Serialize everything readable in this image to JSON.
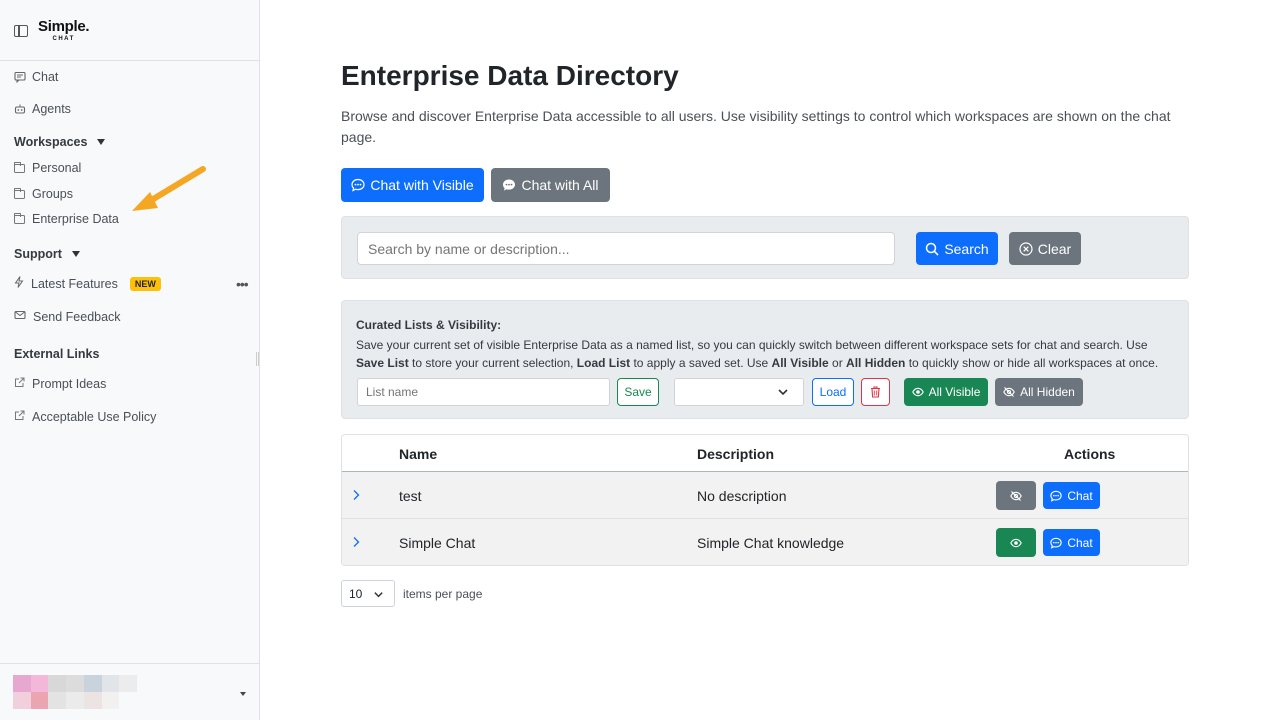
{
  "brand": {
    "line1": "Simple.",
    "line2": "CHAT"
  },
  "sidebar": {
    "chat": "Chat",
    "agents": "Agents",
    "workspaces": {
      "title": "Workspaces",
      "items": [
        "Personal",
        "Groups",
        "Enterprise Data"
      ]
    },
    "support": {
      "title": "Support",
      "latest_features": "Latest Features",
      "new_badge": "NEW",
      "feedback": "Send Feedback"
    },
    "external": {
      "title": "External Links",
      "items": [
        "Prompt Ideas",
        "Acceptable Use Policy"
      ]
    },
    "annotation_arrow_color": "#f5a623"
  },
  "main": {
    "title": "Enterprise Data Directory",
    "lead": "Browse and discover Enterprise Data accessible to all users. Use visibility settings to control which workspaces are shown on the chat page.",
    "chat_visible": "Chat with Visible",
    "chat_all": "Chat with All",
    "search": {
      "placeholder": "Search by name or description...",
      "search_label": "Search",
      "clear_label": "Clear"
    },
    "curated": {
      "title": "Curated Lists & Visibility:",
      "desc_1": "Save your current set of visible Enterprise Data as a named list, so you can quickly switch between different workspace sets for chat and search. Use ",
      "desc_b1": "Save List",
      "desc_2": " to store your current selection, ",
      "desc_b2": "Load List",
      "desc_3": " to apply a saved set. Use ",
      "desc_b3": "All Visible",
      "desc_4": " or ",
      "desc_b4": "All Hidden",
      "desc_5": " to quickly show or hide all workspaces at once.",
      "list_placeholder": "List name",
      "save": "Save",
      "load": "Load",
      "all_visible": "All Visible",
      "all_hidden": "All Hidden"
    },
    "table": {
      "headers": {
        "name": "Name",
        "description": "Description",
        "actions": "Actions"
      },
      "rows": [
        {
          "name": "test",
          "description": "No description",
          "visible": false,
          "chat": "Chat"
        },
        {
          "name": "Simple Chat",
          "description": "Simple Chat knowledge",
          "visible": true,
          "chat": "Chat"
        }
      ]
    },
    "pager": {
      "per_page": "10",
      "label": "items per page"
    }
  },
  "colors": {
    "primary": "#0d6efd",
    "secondary": "#6c757d",
    "success": "#198754",
    "danger": "#dc3545",
    "warning": "#ffc107"
  }
}
